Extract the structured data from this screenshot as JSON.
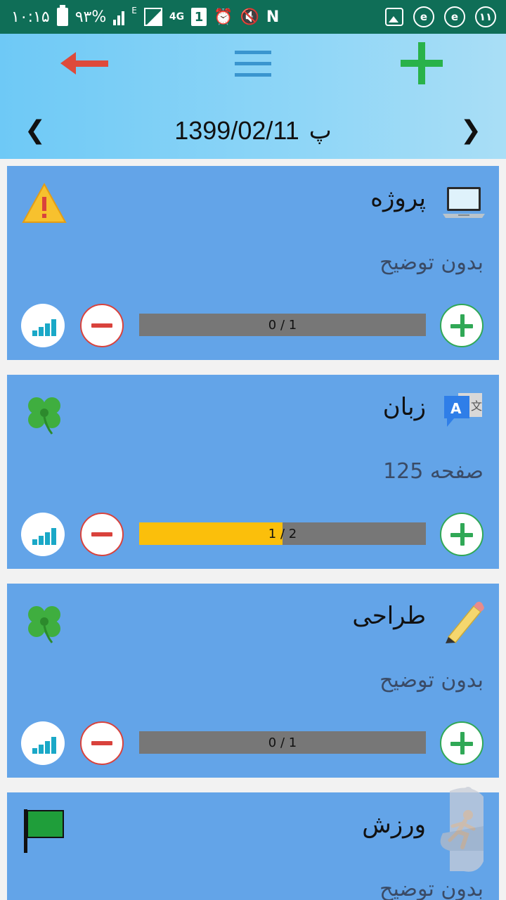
{
  "status_bar": {
    "time": "۱۰:۱۵",
    "battery": "۹۳%",
    "network_type": "4G",
    "sim_slot": "1",
    "network_letter": "E",
    "n_icon": "N",
    "notification_count": "۱۱",
    "icons": [
      "battery-icon",
      "signal-icon",
      "alarm-icon",
      "mute-icon",
      "nfc-icon",
      "gallery-icon",
      "browser-e-icon",
      "browser-e-icon",
      "notification-count-badge"
    ]
  },
  "header": {
    "day_letter": "پ",
    "date": "1399/02/11",
    "prev_glyph": "❮",
    "next_glyph": "❯",
    "icons": {
      "back": "back-arrow-icon",
      "menu": "hamburger-menu-icon",
      "add": "add-plus-icon"
    },
    "colors": {
      "back": "#de4a3b",
      "menu": "#3a95cf",
      "add": "#29b24a"
    }
  },
  "cards": [
    {
      "title": "پروژه",
      "description": "بدون توضیح",
      "progress_label": "0 / 1",
      "progress_fraction": 0,
      "category_icon": "laptop-icon",
      "status_icon": "warning-icon"
    },
    {
      "title": "زبان",
      "description": "صفحه 125",
      "progress_label": "1 / 2",
      "progress_fraction": 0.5,
      "category_icon": "translate-icon",
      "status_icon": "clover-icon"
    },
    {
      "title": "طراحی",
      "description": "بدون توضیح",
      "progress_label": "0 / 1",
      "progress_fraction": 0,
      "category_icon": "pencil-icon",
      "status_icon": "clover-icon"
    },
    {
      "title": "ورزش",
      "description": "بدون توضیح",
      "category_icon": "running-icon",
      "status_icon": "green-flag-icon"
    }
  ],
  "theme": {
    "status_bar_bg": "#0f6e57",
    "card_bg": "#63a4e8",
    "progress_fill": "#fbbf0b",
    "progress_track": "#777777"
  }
}
